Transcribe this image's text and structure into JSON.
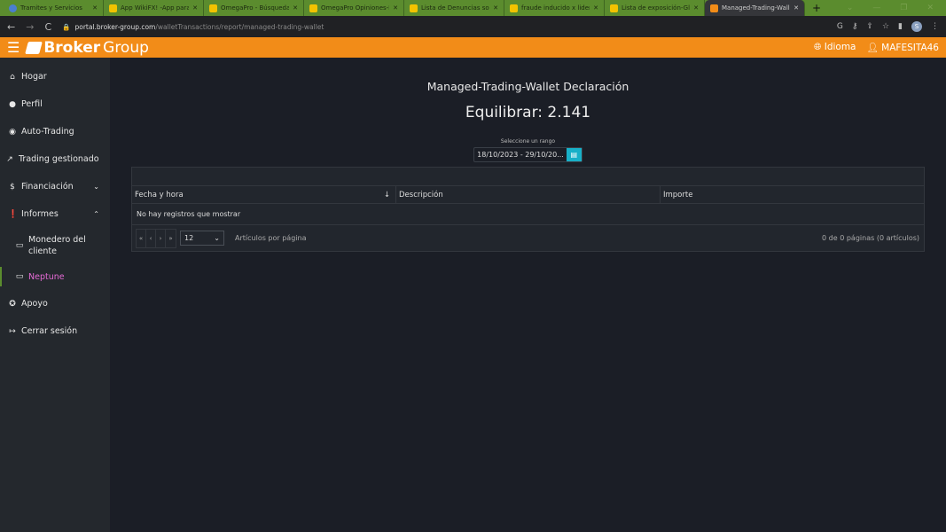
{
  "browser": {
    "tabs": [
      {
        "title": "Tramites y Servicios",
        "active": false
      },
      {
        "title": "App WikiFX! -App para co",
        "active": false
      },
      {
        "title": "OmegaPro - Búsqueda de",
        "active": false
      },
      {
        "title": "OmegaPro Opiniones-Re",
        "active": false
      },
      {
        "title": "Lista de Denuncias sobre",
        "active": false
      },
      {
        "title": "fraude inducido x lideres",
        "active": false
      },
      {
        "title": "Lista de exposición-Glob",
        "active": false
      },
      {
        "title": "Managed-Trading-Wallet",
        "active": true
      }
    ],
    "url_host": "portal.broker-group.com",
    "url_path": "/walletTransactions/report/managed-trading-wallet",
    "profile_initial": "S"
  },
  "header": {
    "brand_bold": "Broker",
    "brand_light": "Group",
    "language": "Idioma",
    "user": "MAFESITA46",
    "accent": "#f28c18"
  },
  "sidebar": {
    "items": [
      {
        "label": "Hogar",
        "icon": "home-icon"
      },
      {
        "label": "Perfil",
        "icon": "user-icon"
      },
      {
        "label": "Auto-Trading",
        "icon": "bulb-icon"
      },
      {
        "label": "Trading gestionado",
        "icon": "trend-icon"
      },
      {
        "label": "Financiación",
        "icon": "money-icon"
      },
      {
        "label": "Informes",
        "icon": "alert-icon"
      },
      {
        "label": "Monedero del cliente",
        "icon": "wallet-icon"
      },
      {
        "label": "Neptune",
        "icon": "wallet-icon",
        "selected": true
      },
      {
        "label": "Apoyo",
        "icon": "lifebuoy-icon"
      },
      {
        "label": "Cerrar sesión",
        "icon": "logout-icon"
      }
    ]
  },
  "main": {
    "title": "Managed-Trading-Wallet Declaración",
    "balance": "Equilibrar: 2.141",
    "range_label": "Seleccione un rango",
    "range_value": "18/10/2023 - 29/10/20...",
    "columns": [
      "Fecha y hora",
      "Descripción",
      "Importe"
    ],
    "empty": "No hay registros que mostrar",
    "page_size": "12",
    "per_page_label": "Artículos por página",
    "page_info": "0 de 0 páginas (0 artículos)"
  }
}
